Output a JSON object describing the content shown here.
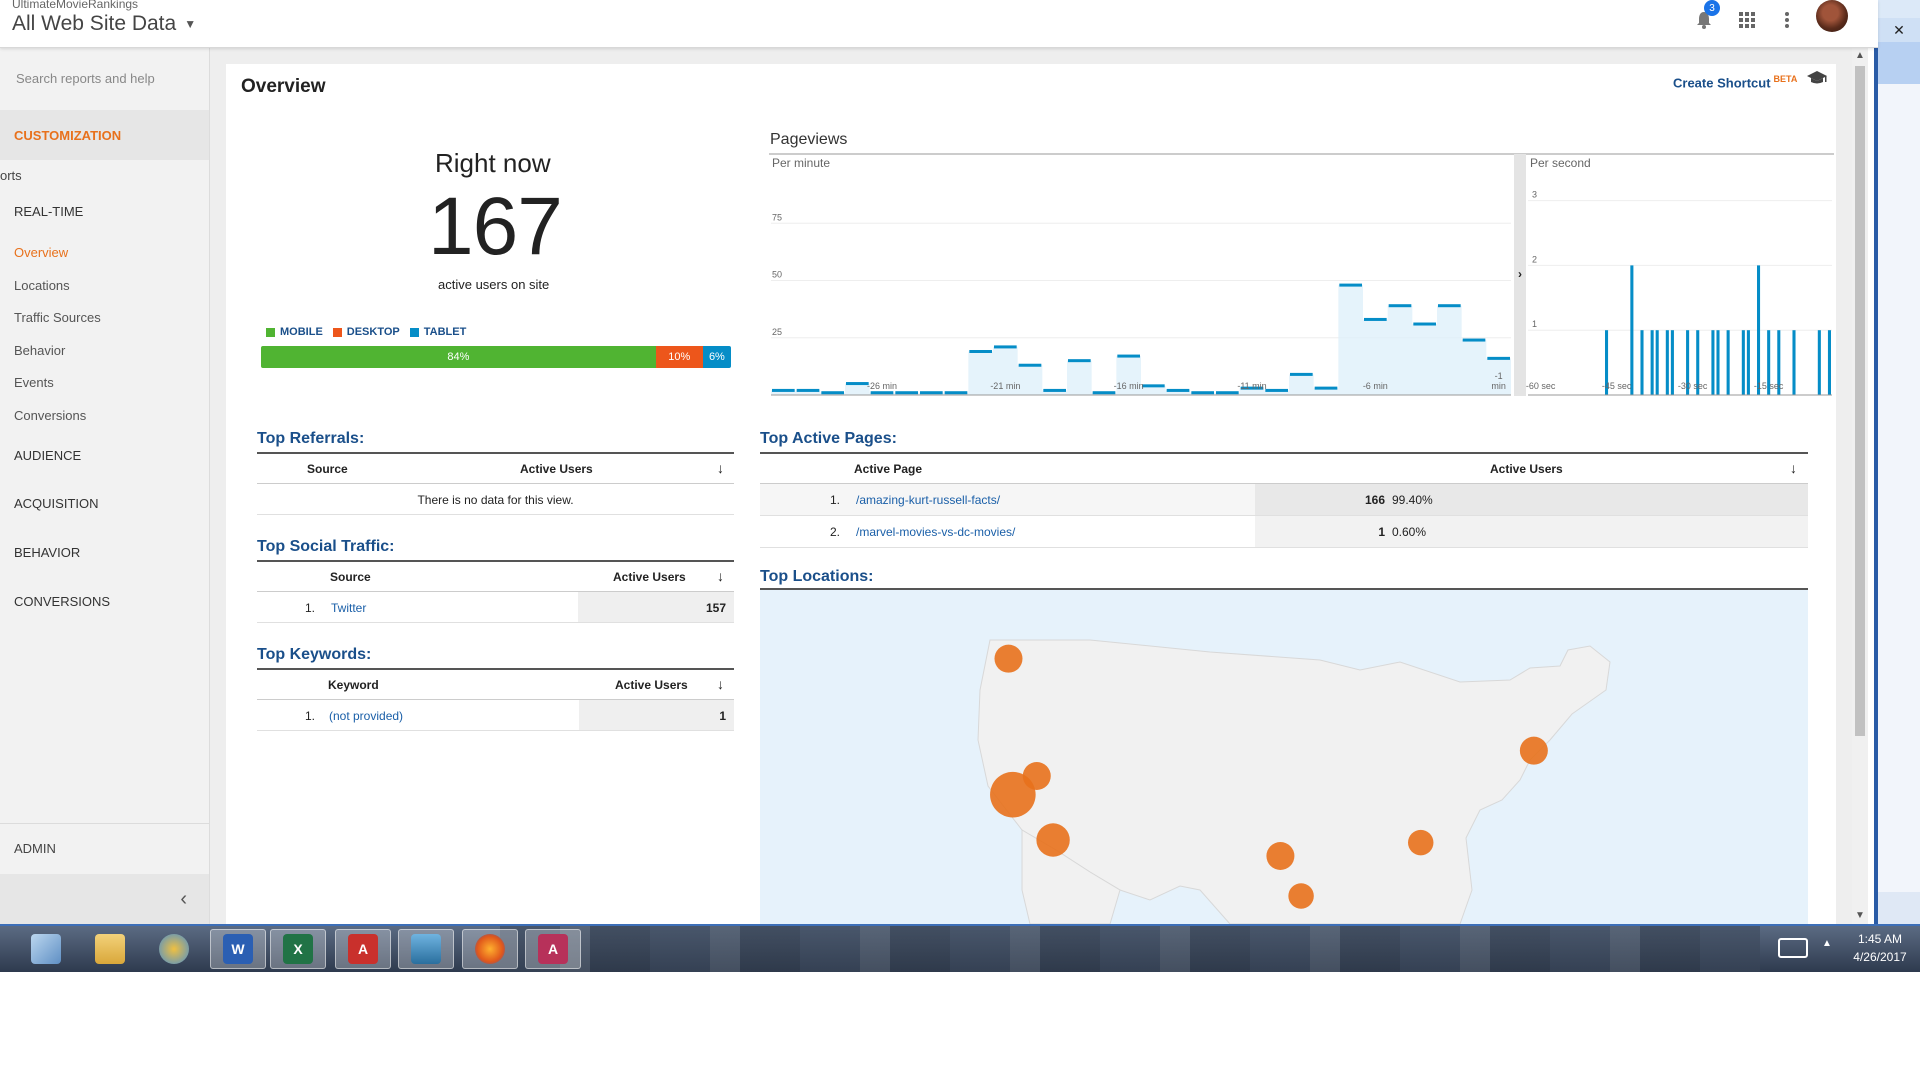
{
  "header": {
    "account": "UltimateMovieRankings",
    "property": "All Web Site Data",
    "notification_count": "3"
  },
  "sidebar": {
    "search_placeholder": "Search reports and help",
    "customization": "CUSTOMIZATION",
    "reports_label": "orts",
    "realtime": "REAL-TIME",
    "realtime_items": [
      "Overview",
      "Locations",
      "Traffic Sources",
      "Behavior",
      "Events",
      "Conversions"
    ],
    "audience": "AUDIENCE",
    "acquisition": "ACQUISITION",
    "behavior": "BEHAVIOR",
    "conversions": "CONVERSIONS",
    "admin": "ADMIN"
  },
  "page": {
    "title": "Overview",
    "shortcut": "Create Shortcut",
    "shortcut_badge": "BETA"
  },
  "right_now": {
    "label": "Right now",
    "count": "167",
    "sub": "active users on site",
    "legend": [
      "MOBILE",
      "DESKTOP",
      "TABLET"
    ],
    "mobile_pct": "84%",
    "desktop_pct": "10%",
    "tablet_pct": "6%",
    "mobile_share": 0.84,
    "desktop_share": 0.1,
    "tablet_share": 0.06
  },
  "colors": {
    "mobile": "#50b432",
    "desktop": "#ed561b",
    "tablet": "#058dc7",
    "accent": "#e8711c",
    "link": "#1a4f8a",
    "bar": "#058dc7"
  },
  "top_referrals": {
    "title": "Top Referrals:",
    "col_source": "Source",
    "col_users": "Active Users",
    "empty": "There is no data for this view."
  },
  "top_social": {
    "title": "Top Social Traffic:",
    "col_source": "Source",
    "col_users": "Active Users",
    "rows": [
      {
        "rank": "1.",
        "name": "Twitter",
        "value": "157"
      }
    ]
  },
  "top_keywords": {
    "title": "Top Keywords:",
    "col_keyword": "Keyword",
    "col_users": "Active Users",
    "rows": [
      {
        "rank": "1.",
        "name": "(not provided)",
        "value": "1"
      }
    ]
  },
  "top_pages": {
    "title": "Top Active Pages:",
    "col_page": "Active Page",
    "col_users": "Active Users",
    "rows": [
      {
        "rank": "1.",
        "page": "/amazing-kurt-russell-facts/",
        "value": "166",
        "pct": "99.40%"
      },
      {
        "rank": "2.",
        "page": "/marvel-movies-vs-dc-movies/",
        "value": "1",
        "pct": "0.60%"
      }
    ]
  },
  "top_locations": {
    "title": "Top Locations:"
  },
  "chart_data": [
    {
      "type": "bar",
      "title": "Pageviews",
      "subtitle": "Per minute",
      "y_ticks": [
        "25",
        "50",
        "75"
      ],
      "ylim": [
        0,
        100
      ],
      "x_ticks": [
        "-26 min",
        "-21 min",
        "-16 min",
        "-11 min",
        "-6 min",
        "-1 min"
      ],
      "x": [
        -30,
        -29,
        -28,
        -27,
        -26,
        -25,
        -24,
        -23,
        -22,
        -21,
        -20,
        -19,
        -18,
        -17,
        -16,
        -15,
        -14,
        -13,
        -12,
        -11,
        -10,
        -9,
        -8,
        -7,
        -6,
        -5,
        -4,
        -3,
        -2,
        -1
      ],
      "values": [
        2,
        2,
        1,
        5,
        1,
        1,
        1,
        1,
        19,
        21,
        13,
        2,
        15,
        1,
        17,
        4,
        2,
        1,
        1,
        3,
        2,
        9,
        3,
        48,
        33,
        39,
        31,
        39,
        24,
        16
      ]
    },
    {
      "type": "bar",
      "subtitle": "Per second",
      "y_ticks": [
        "1",
        "2",
        "3"
      ],
      "ylim": [
        0,
        3.5
      ],
      "x_ticks": [
        "-60 sec",
        "-45 sec",
        "-30 sec",
        "-15 sec"
      ],
      "x": [
        -60,
        -59,
        -58,
        -57,
        -56,
        -55,
        -54,
        -53,
        -52,
        -51,
        -50,
        -49,
        -48,
        -47,
        -46,
        -45,
        -44,
        -43,
        -42,
        -41,
        -40,
        -39,
        -38,
        -37,
        -36,
        -35,
        -34,
        -33,
        -32,
        -31,
        -30,
        -29,
        -28,
        -27,
        -26,
        -25,
        -24,
        -23,
        -22,
        -21,
        -20,
        -19,
        -18,
        -17,
        -16,
        -15,
        -14,
        -13,
        -12,
        -11,
        -10,
        -9,
        -8,
        -7,
        -6,
        -5,
        -4,
        -3,
        -2,
        -1
      ],
      "values": [
        0,
        0,
        0,
        0,
        0,
        0,
        0,
        0,
        0,
        0,
        0,
        0,
        0,
        0,
        0,
        1,
        0,
        0,
        0,
        0,
        2,
        0,
        1,
        0,
        1,
        1,
        0,
        1,
        1,
        0,
        0,
        1,
        0,
        1,
        0,
        0,
        1,
        1,
        0,
        1,
        0,
        0,
        1,
        1,
        0,
        2,
        0,
        1,
        0,
        1,
        0,
        0,
        1,
        0,
        0,
        0,
        0,
        1,
        0,
        1
      ]
    }
  ],
  "map_data": {
    "locations": [
      {
        "lon": -122.3,
        "lat": 47.6,
        "size": 1
      },
      {
        "lon": -121.9,
        "lat": 37.4,
        "size": 3
      },
      {
        "lon": -119.7,
        "lat": 38.8,
        "size": 1
      },
      {
        "lon": -118.2,
        "lat": 34.0,
        "size": 1.5
      },
      {
        "lon": -97.3,
        "lat": 32.8,
        "size": 1
      },
      {
        "lon": -95.4,
        "lat": 29.8,
        "size": 0.8
      },
      {
        "lon": -84.4,
        "lat": 33.8,
        "size": 0.8
      },
      {
        "lon": -74.0,
        "lat": 40.7,
        "size": 1
      }
    ]
  },
  "taskbar": {
    "time": "1:45 AM",
    "date": "4/26/2017"
  }
}
